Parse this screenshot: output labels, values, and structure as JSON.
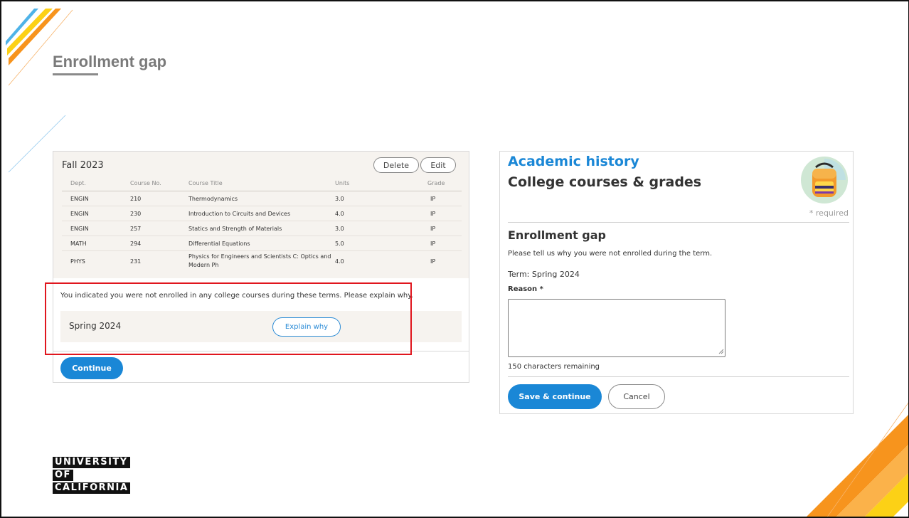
{
  "slide": {
    "title": "Enrollment gap"
  },
  "left_panel": {
    "term": "Fall 2023",
    "buttons": {
      "delete": "Delete",
      "edit": "Edit"
    },
    "columns": [
      "Dept.",
      "Course No.",
      "Course Title",
      "Units",
      "Grade"
    ],
    "rows": [
      [
        "ENGIN",
        "210",
        "Thermodynamics",
        "3.0",
        "IP"
      ],
      [
        "ENGIN",
        "230",
        "Introduction to Circuits and Devices",
        "4.0",
        "IP"
      ],
      [
        "ENGIN",
        "257",
        "Statics and Strength of Materials",
        "3.0",
        "IP"
      ],
      [
        "MATH",
        "294",
        "Differential Equations",
        "5.0",
        "IP"
      ],
      [
        "PHYS",
        "231",
        "Physics for Engineers and Scientists C: Optics and Modern Ph",
        "4.0",
        "IP"
      ]
    ],
    "gap_message": "You indicated you were not enrolled in any college courses during these terms. Please explain why.",
    "gap_term": "Spring 2024",
    "explain_button": "Explain why",
    "continue_button": "Continue"
  },
  "right_panel": {
    "kicker": "Academic history",
    "title": "College courses & grades",
    "required_note": "* required",
    "section_title": "Enrollment gap",
    "description": "Please tell us why you were not enrolled during the term.",
    "term_label": "Term: Spring 2024",
    "reason_label": "Reason *",
    "reason_value": "",
    "chars_remaining": "150 characters remaining",
    "save_button": "Save & continue",
    "cancel_button": "Cancel",
    "icon": "backpack-icon"
  },
  "logo": {
    "lines": [
      "UNIVERSITY",
      "OF",
      "CALIFORNIA"
    ]
  },
  "colors": {
    "accent_blue": "#1a87d6",
    "highlight_red": "#e0161e",
    "deco_orange": "#f7941d",
    "deco_yellow": "#fcd116",
    "deco_blue": "#4fb3e8"
  }
}
